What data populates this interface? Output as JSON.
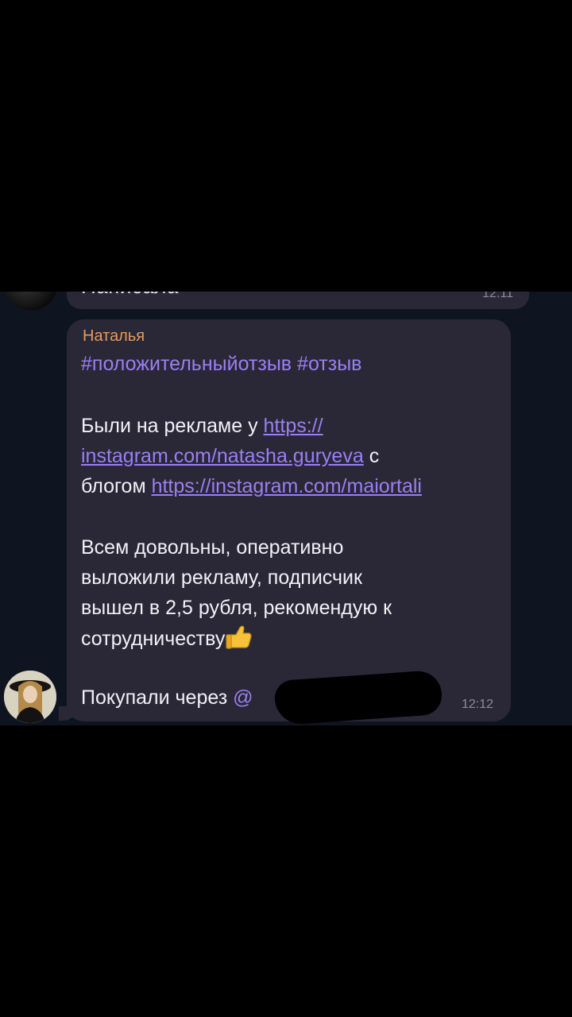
{
  "previous_message": {
    "text": "Написала",
    "time": "12:11"
  },
  "message": {
    "sender": "Наталья",
    "hashtags": "#положительныйотзыв #отзыв",
    "para1": {
      "text_before": "Были на рекламе у ",
      "link1_line1": "https://",
      "link1_line2": "instagram.com/natasha.guryeva",
      "text_mid": " с",
      "text_blog": "блогом ",
      "link2": "https://instagram.com/maiortali"
    },
    "para2": {
      "line1": "Всем довольны, оперативно",
      "line2": "выложили рекламу, подписчик",
      "line3": "вышел в 2,5 рубля, рекомендую к",
      "line4": "сотрудничеству"
    },
    "last_line": "Покупали через ",
    "mention_prefix": "@",
    "time": "12:12",
    "emoji": "thumbs-up-icon"
  },
  "colors": {
    "bubble": "#2a2837",
    "link": "#9a7ff4",
    "sender": "#e69a5c"
  }
}
